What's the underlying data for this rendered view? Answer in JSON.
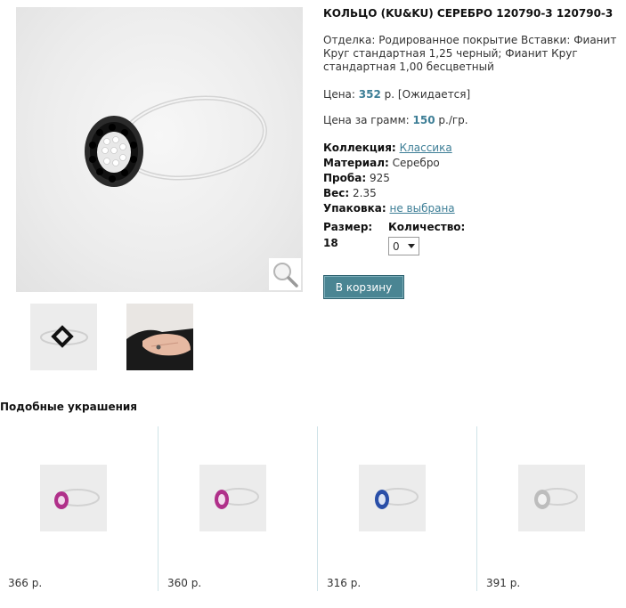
{
  "product": {
    "title": "КОЛЬЦО (KU&KU) СЕРЕБРО 120790-3 120790-3",
    "description": "Отделка: Родированное покрытие Вставки: Фианит Круг стандартная 1,25 черный; Фианит Круг стандартная 1,00 бесцветный",
    "price_label": "Цена:",
    "price_value": "352",
    "price_suffix": "р. [Ожидается]",
    "gram_label": "Цена за грамм:",
    "gram_value": "150",
    "gram_suffix": "р./гр.",
    "collection_label": "Коллекция:",
    "collection_value": "Классика",
    "material_label": "Материал:",
    "material_value": "Серебро",
    "probe_label": "Проба:",
    "probe_value": "925",
    "weight_label": "Вес:",
    "weight_value": "2.35",
    "package_label": "Упаковка:",
    "package_value": "не выбрана",
    "size_label": "Размер:",
    "size_value": "18",
    "qty_label": "Количество:",
    "qty_value": "0",
    "cart_button": "В корзину"
  },
  "similar": {
    "heading": "Подобные украшения",
    "items": [
      {
        "price": "366 р.",
        "stone_color": "#b0308a"
      },
      {
        "price": "360 р.",
        "stone_color": "#b0308a"
      },
      {
        "price": "316 р.",
        "stone_color": "#2a4fa8"
      },
      {
        "price": "391 р.",
        "stone_color": "#cfcfcf"
      }
    ]
  },
  "colors": {
    "accent": "#3d7e96",
    "button_bg": "#4a8593"
  }
}
